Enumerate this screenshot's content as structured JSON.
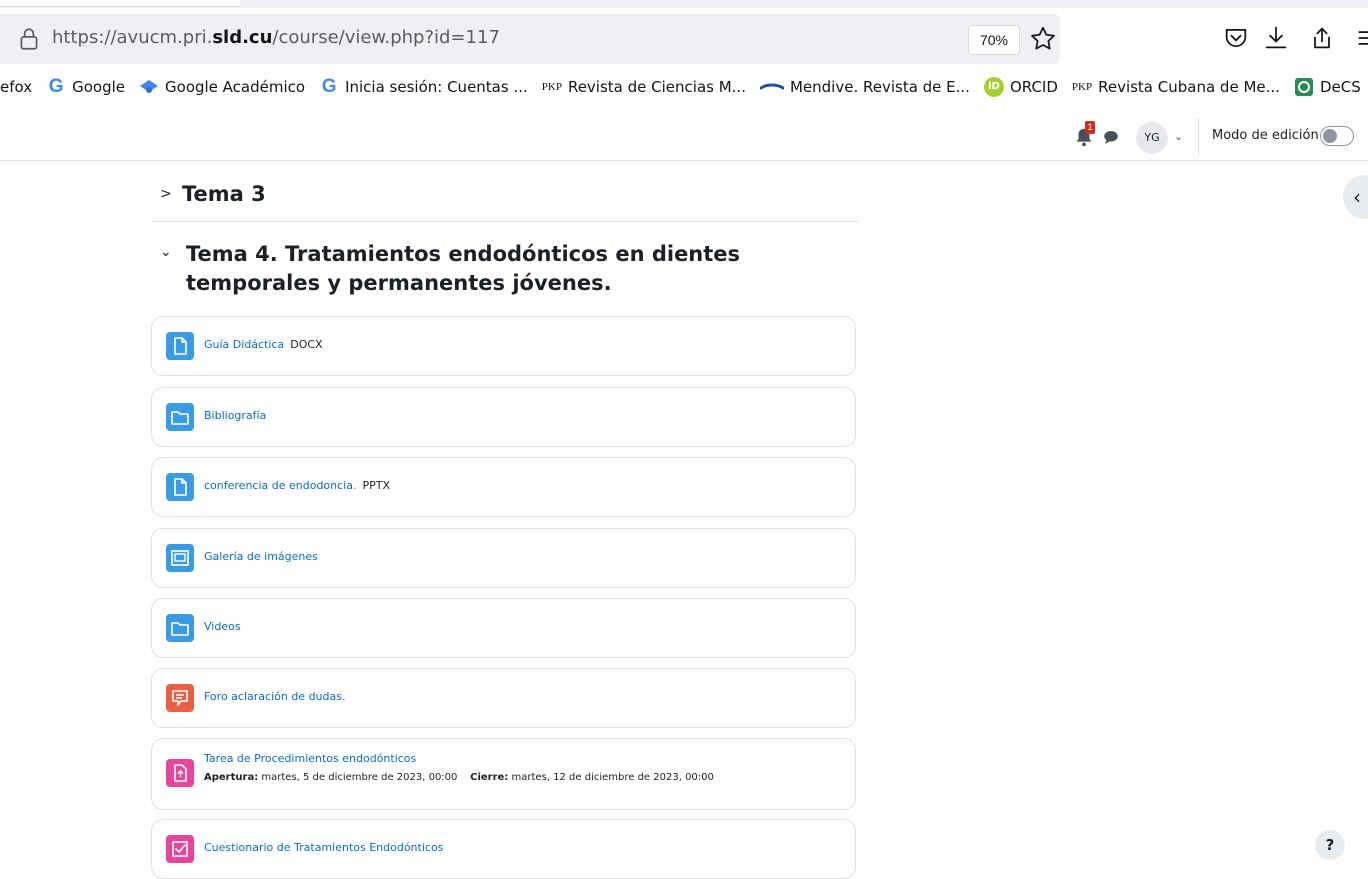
{
  "browser": {
    "url_prefix": "https://avucm.pri.",
    "url_host": "sld.cu",
    "url_path": "/course/view.php?id=117",
    "zoom": "70%"
  },
  "bookmarks": [
    {
      "label": "efox",
      "icon": "none"
    },
    {
      "label": "Google",
      "icon": "google-icon"
    },
    {
      "label": "Google Académico",
      "icon": "scholar-icon"
    },
    {
      "label": "Inicia sesión: Cuentas ...",
      "icon": "google-icon"
    },
    {
      "label": "Revista de Ciencias M...",
      "icon": "pkp-icon"
    },
    {
      "label": "Mendive. Revista de E...",
      "icon": "mendive-icon"
    },
    {
      "label": "ORCID",
      "icon": "orcid-icon"
    },
    {
      "label": "Revista Cubana de Me...",
      "icon": "pkp-icon"
    },
    {
      "label": "DeCS",
      "icon": "decs-icon"
    }
  ],
  "icon_text": {
    "pkp": "PKP",
    "orcid": "iD",
    "google": "G"
  },
  "nav": {
    "notification_count": "1",
    "avatar_initials": "YG",
    "edit_mode_label": "Modo de edición"
  },
  "sections": {
    "tema3": {
      "title": "Tema 3"
    },
    "tema4": {
      "title": "Tema 4. Tratamientos endodónticos en dientes temporales y permanentes jóvenes."
    }
  },
  "activities": [
    {
      "name": "Guía Didáctica",
      "type": "DOCX",
      "icon": "file-icon",
      "color": "#399be2"
    },
    {
      "name": "Bibliografía",
      "type": "",
      "icon": "folder-icon",
      "color": "#399be2"
    },
    {
      "name": "conferencia de endodoncia.",
      "type": "PPTX",
      "icon": "file-icon",
      "color": "#399be2"
    },
    {
      "name": "Galería de imágenes",
      "type": "",
      "icon": "image-gallery-icon",
      "color": "#399be2"
    },
    {
      "name": "Videos",
      "type": "",
      "icon": "folder-icon",
      "color": "#399be2"
    },
    {
      "name": "Foro aclaración de dudas.",
      "type": "",
      "icon": "forum-icon",
      "color": "#eb6145"
    },
    {
      "name": "Tarea de Procedimientos endodónticos",
      "type": "",
      "icon": "assignment-icon",
      "color": "#e6479a",
      "opening_label": "Apertura:",
      "opening_date": "martes, 5 de diciembre de 2023, 00:00",
      "closing_label": "Cierre:",
      "closing_date": "martes, 12 de diciembre de 2023, 00:00"
    },
    {
      "name": "Cuestionario de Tratamientos Endodónticos",
      "type": "",
      "icon": "quiz-icon",
      "color": "#e6479a"
    }
  ],
  "help": {
    "label": "?"
  }
}
